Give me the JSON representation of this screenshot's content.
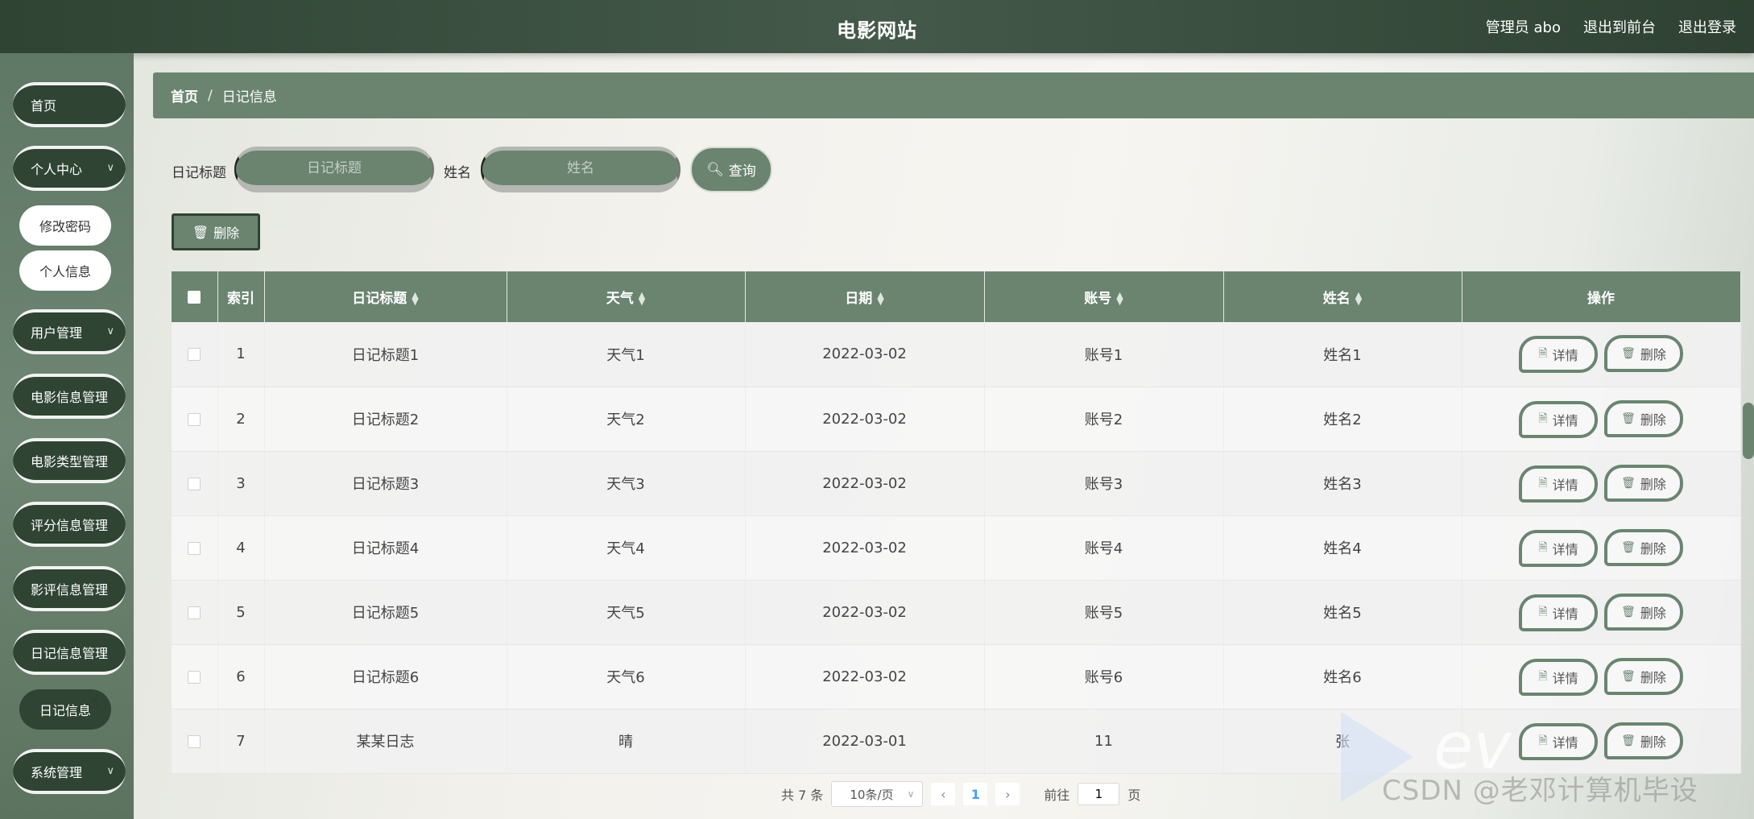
{
  "header": {
    "site_title": "电影网站",
    "admin_label": "管理员 abo",
    "back_to_front": "退出到前台",
    "logout": "退出登录"
  },
  "sidebar": {
    "items": [
      {
        "label": "首页"
      },
      {
        "label": "个人中心",
        "expanded": true,
        "children": [
          "修改密码",
          "个人信息"
        ]
      },
      {
        "label": "用户管理"
      },
      {
        "label": "电影信息管理"
      },
      {
        "label": "电影类型管理"
      },
      {
        "label": "评分信息管理"
      },
      {
        "label": "影评信息管理"
      },
      {
        "label": "日记信息管理",
        "expanded": true,
        "children": [
          "日记信息"
        ]
      },
      {
        "label": "系统管理"
      }
    ]
  },
  "breadcrumb": {
    "home": "首页",
    "separator": "/",
    "current": "日记信息"
  },
  "search": {
    "title_label": "日记标题",
    "title_placeholder": "日记标题",
    "name_label": "姓名",
    "name_placeholder": "姓名",
    "query_button": "查询"
  },
  "toolbar": {
    "delete_button": "删除"
  },
  "table": {
    "columns": [
      "索引",
      "日记标题",
      "天气",
      "日期",
      "账号",
      "姓名",
      "操作"
    ],
    "rows": [
      [
        "1",
        "日记标题1",
        "天气1",
        "2022-03-02",
        "账号1",
        "姓名1"
      ],
      [
        "2",
        "日记标题2",
        "天气2",
        "2022-03-02",
        "账号2",
        "姓名2"
      ],
      [
        "3",
        "日记标题3",
        "天气3",
        "2022-03-02",
        "账号3",
        "姓名3"
      ],
      [
        "4",
        "日记标题4",
        "天气4",
        "2022-03-02",
        "账号4",
        "姓名4"
      ],
      [
        "5",
        "日记标题5",
        "天气5",
        "2022-03-02",
        "账号5",
        "姓名5"
      ],
      [
        "6",
        "日记标题6",
        "天气6",
        "2022-03-02",
        "账号6",
        "姓名6"
      ],
      [
        "7",
        "某某日志",
        "晴",
        "2022-03-01",
        "11",
        "张"
      ]
    ],
    "detail_button": "详情",
    "delete_button": "删除"
  },
  "pagination": {
    "total": "共 7 条",
    "page_size": "10条/页",
    "current_page": "1",
    "goto_label": "前往",
    "goto_value": "1",
    "page_unit": "页"
  },
  "watermark": {
    "text": "CSDN @老邓计算机毕设"
  },
  "colors": {
    "primary": "#6a8470",
    "dark": "#2f4433",
    "header": "#3b5140"
  }
}
